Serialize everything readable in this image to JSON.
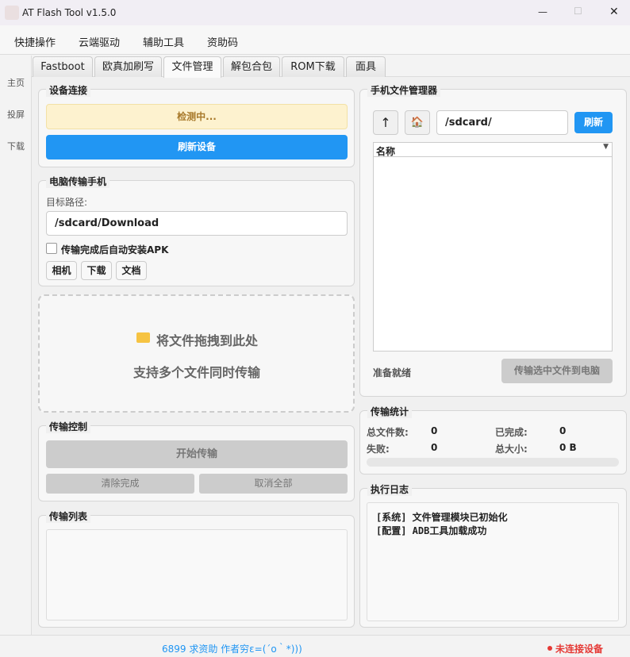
{
  "window": {
    "title": "AT Flash Tool v1.5.0",
    "min": "—",
    "max": "☐",
    "close": "✕"
  },
  "menu": [
    "快捷操作",
    "云端驱动",
    "辅助工具",
    "资助码"
  ],
  "sidebar": [
    "主页",
    "投屏",
    "下载"
  ],
  "tabs": [
    "Fastboot",
    "欧真加刷写",
    "文件管理",
    "解包合包",
    "ROM下载",
    "面具"
  ],
  "device": {
    "title": "设备连接",
    "status": "检测中...",
    "refresh": "刷新设备"
  },
  "pc_to_phone": {
    "title": "电脑传输手机",
    "target_label": "目标路径:",
    "target_value": "/sdcard/Download",
    "auto_install": "传输完成后自动安装APK",
    "quick": [
      "相机",
      "下载",
      "文档"
    ]
  },
  "drop": {
    "icon": "folder-icon",
    "line1": "将文件拖拽到此处",
    "line2": "支持多个文件同时传输"
  },
  "control": {
    "title": "传输控制",
    "start": "开始传输",
    "clear": "清除完成",
    "cancel": "取消全部"
  },
  "list": {
    "title": "传输列表"
  },
  "fm": {
    "title": "手机文件管理器",
    "up": "↑",
    "home": "🏠",
    "path": "/sdcard/",
    "refresh": "刷新",
    "col_name": "名称",
    "status": "准备就绪",
    "transfer": "传输选中文件到电脑"
  },
  "stats": {
    "title": "传输统计",
    "total_label": "总文件数:",
    "total": "0",
    "done_label": "已完成:",
    "done": "0",
    "fail_label": "失败:",
    "fail": "0",
    "size_label": "总大小:",
    "size": "0 B",
    "progress": 0
  },
  "log": {
    "title": "执行日志",
    "lines": [
      "[系统] 文件管理模块已初始化",
      "[配置] ADB工具加载成功"
    ]
  },
  "statusbar": {
    "left": "6899  求资助 作者穷ε=(´ο｀*)))",
    "right": "未连接设备",
    "accent": "#2196f3",
    "error": "#e53935"
  }
}
